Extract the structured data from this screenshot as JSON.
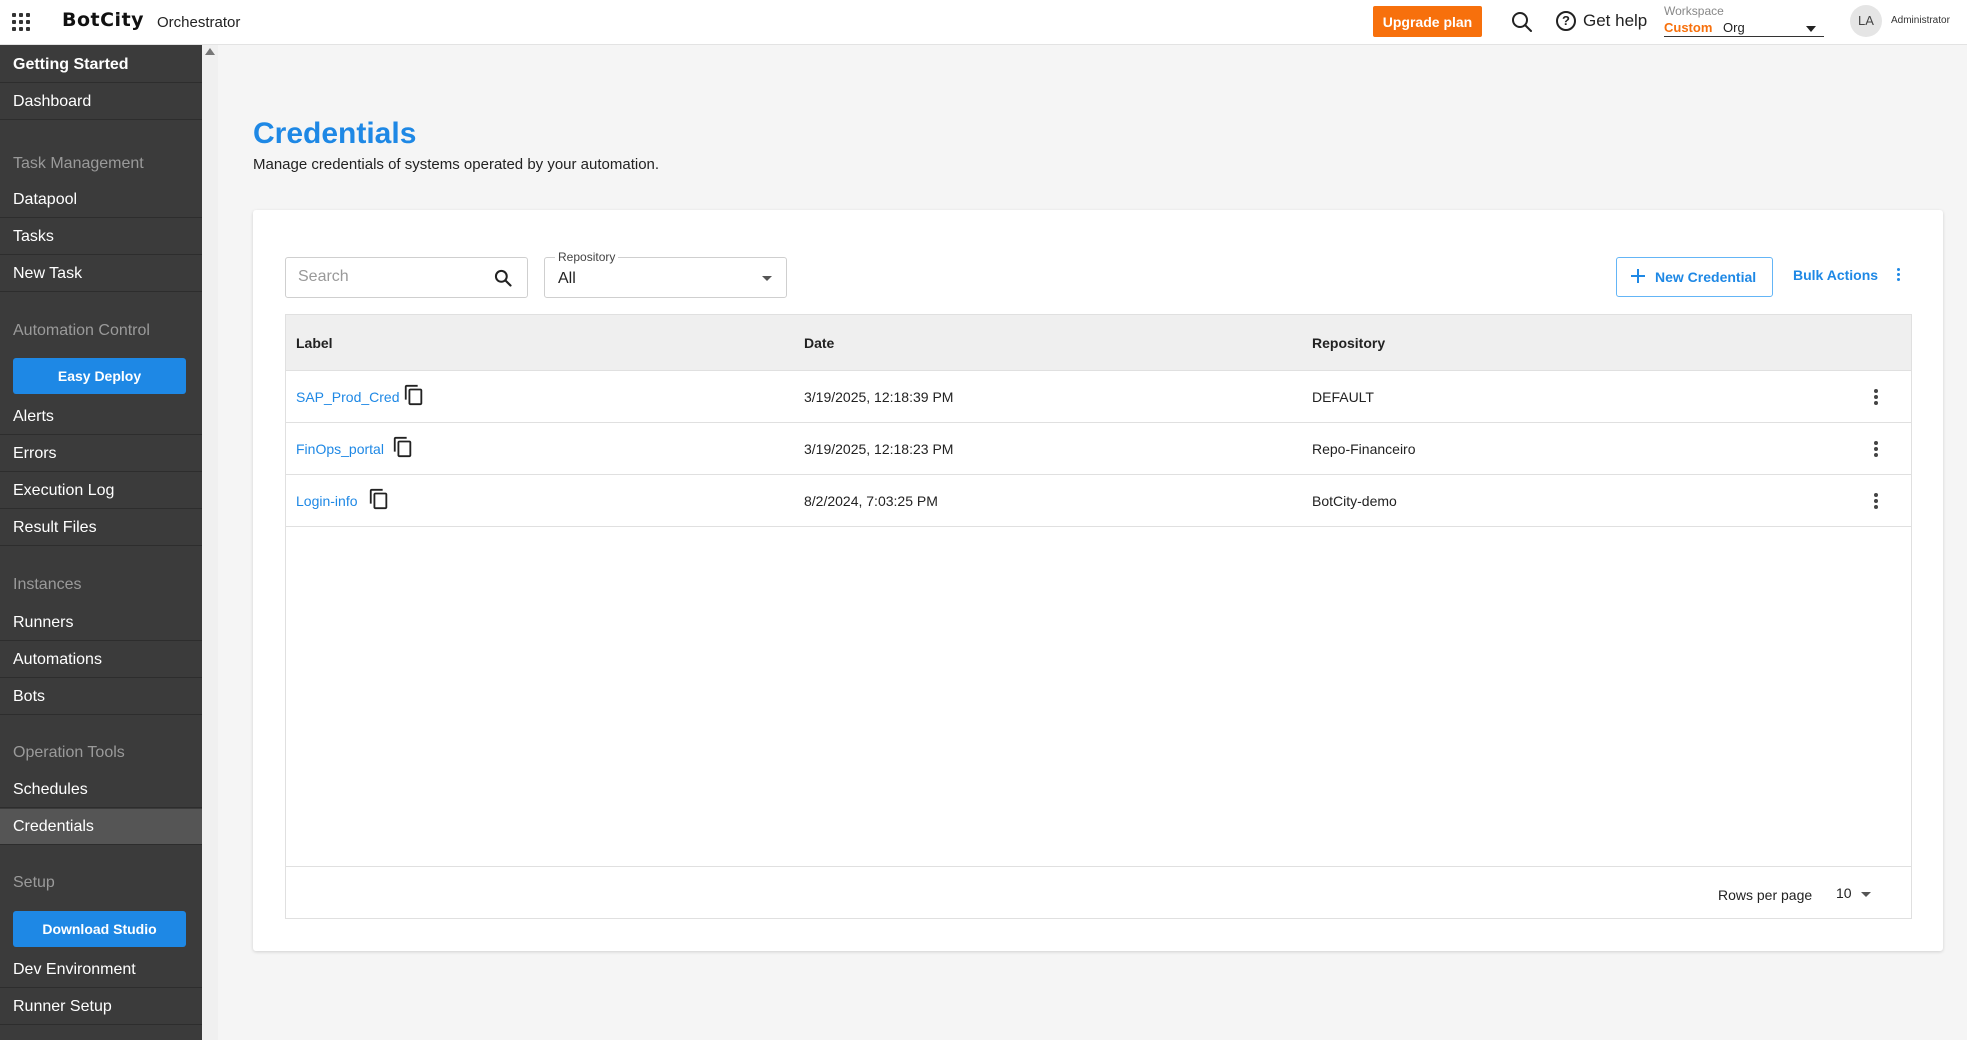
{
  "header": {
    "logo": "BotCity",
    "app_name": "Orchestrator",
    "upgrade_label": "Upgrade plan",
    "help_label": "Get help",
    "workspace": {
      "label": "Workspace",
      "plan": "Custom",
      "org": "Org"
    },
    "avatar_initials": "LA",
    "user_role": "Administrator"
  },
  "sidebar": {
    "getting_started": "Getting Started",
    "dashboard": "Dashboard",
    "task_management": "Task Management",
    "datapool": "Datapool",
    "tasks": "Tasks",
    "new_task": "New Task",
    "automation_control": "Automation Control",
    "easy_deploy": "Easy Deploy",
    "alerts": "Alerts",
    "errors": "Errors",
    "execution_log": "Execution Log",
    "result_files": "Result Files",
    "instances": "Instances",
    "runners": "Runners",
    "automations": "Automations",
    "bots": "Bots",
    "operation_tools": "Operation Tools",
    "schedules": "Schedules",
    "credentials": "Credentials",
    "setup": "Setup",
    "download_studio": "Download Studio",
    "dev_environment": "Dev Environment",
    "runner_setup": "Runner Setup"
  },
  "page": {
    "title": "Credentials",
    "subtitle": "Manage credentials of systems operated by your automation."
  },
  "toolbar": {
    "search_placeholder": "Search",
    "repository_label": "Repository",
    "repository_value": "All",
    "new_credential": "New Credential",
    "bulk_actions": "Bulk Actions"
  },
  "table": {
    "columns": [
      "Label",
      "Date",
      "Repository"
    ],
    "rows": [
      {
        "label": "SAP_Prod_Cred",
        "date": "3/19/2025, 12:18:39 PM",
        "repository": "DEFAULT"
      },
      {
        "label": "FinOps_portal",
        "date": "3/19/2025, 12:18:23 PM",
        "repository": "Repo-Financeiro"
      },
      {
        "label": "Login-info",
        "date": "8/2/2024, 7:03:25 PM",
        "repository": "BotCity-demo"
      }
    ],
    "footer": {
      "rows_per_page_label": "Rows per page",
      "rows_per_page": "10"
    }
  },
  "colors": {
    "accent": "#1e88e5",
    "brand_orange": "#f7700c",
    "sidebar_bg": "#3b3b3b"
  }
}
